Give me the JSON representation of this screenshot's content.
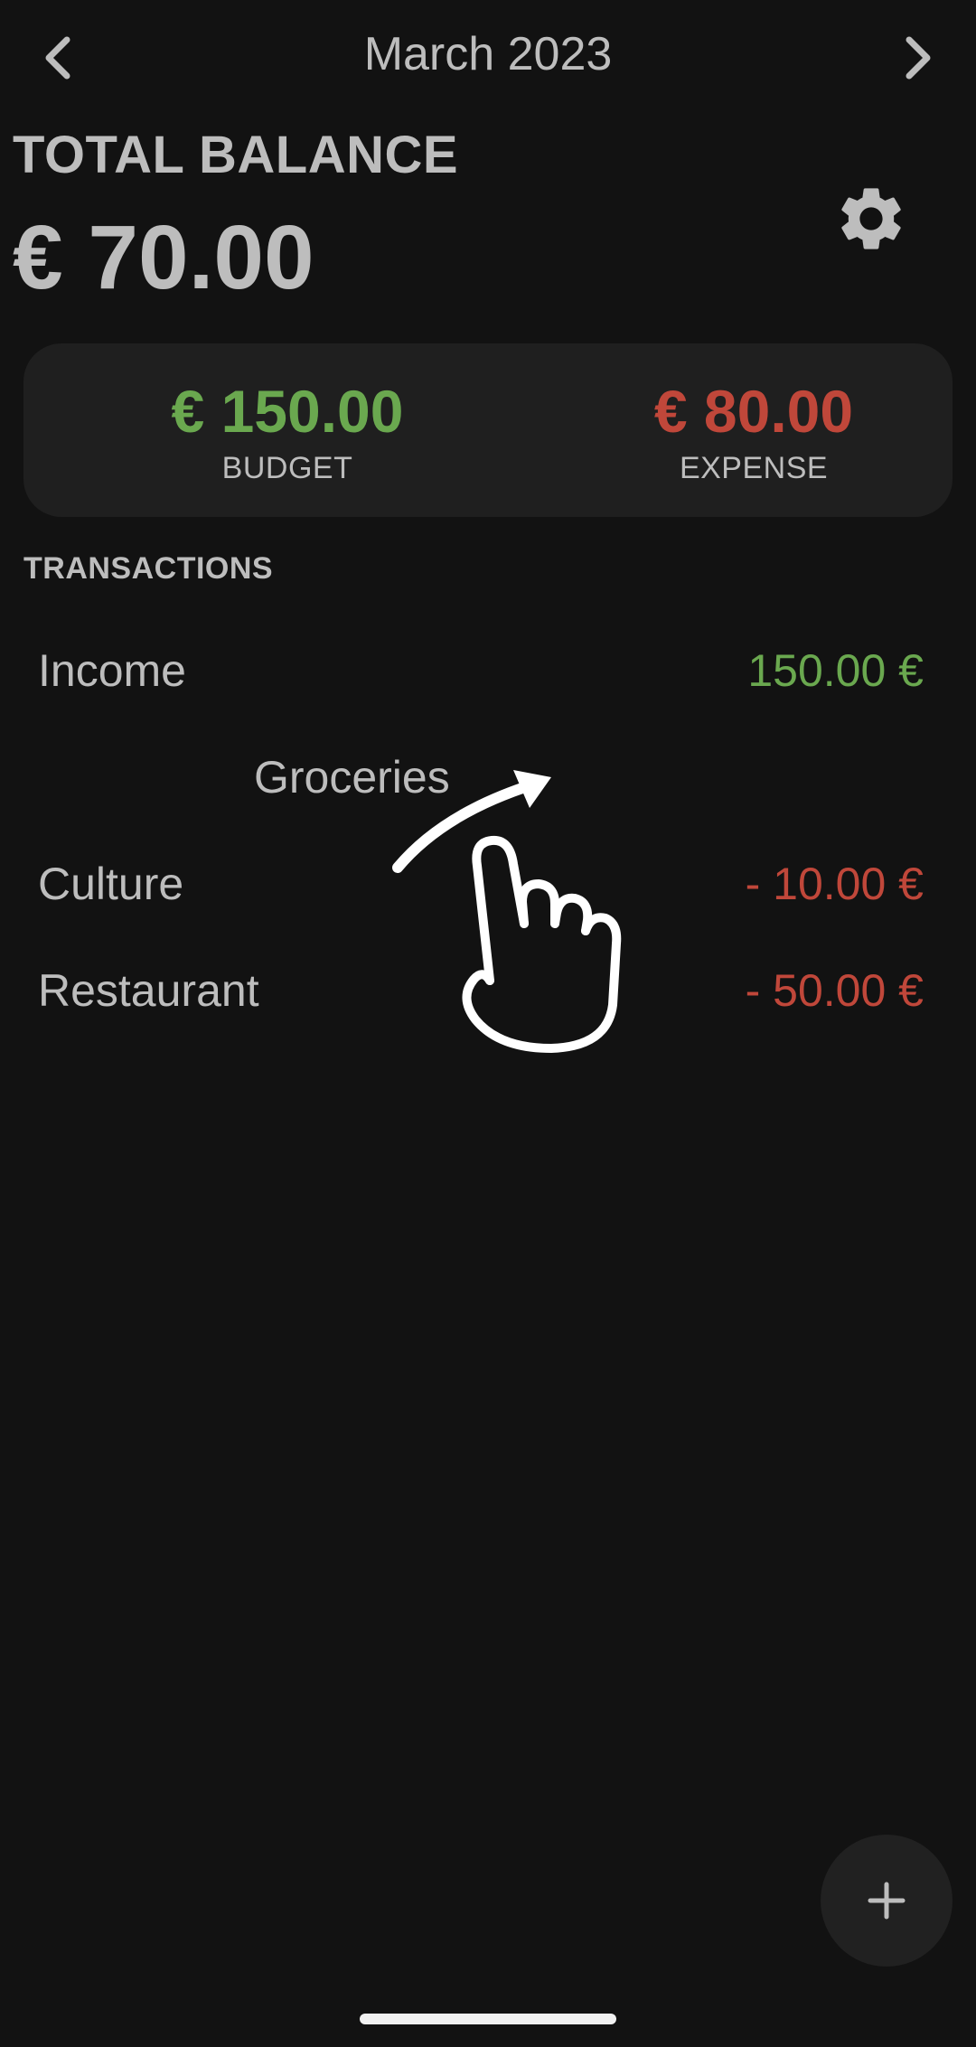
{
  "header": {
    "month_label": "March 2023",
    "prev_icon": "chevron-left-icon",
    "next_icon": "chevron-right-icon"
  },
  "balance": {
    "label": "TOTAL BALANCE",
    "value": "€ 70.00",
    "settings_icon": "gear-icon"
  },
  "summary": {
    "budget": {
      "amount": "€ 150.00",
      "label": "BUDGET",
      "color": "#6aa84f"
    },
    "expense": {
      "amount": "€ 80.00",
      "label": "EXPENSE",
      "color": "#c0473a"
    }
  },
  "transactions": {
    "title": "TRANSACTIONS",
    "items": [
      {
        "name": "Income",
        "amount": "150.00 €"
      },
      {
        "name": "Groceries",
        "amount": ""
      },
      {
        "name": "Culture",
        "amount": "- 10.00 €"
      },
      {
        "name": "Restaurant",
        "amount": "- 50.00 €"
      }
    ]
  },
  "gesture_hint": {
    "icon": "swipe-hand-icon"
  },
  "fab": {
    "icon": "plus-icon"
  },
  "colors": {
    "background": "#121212",
    "card": "#1f1f1f",
    "income": "#6aa84f",
    "expense": "#c0473a",
    "text": "#bdbdbd"
  }
}
